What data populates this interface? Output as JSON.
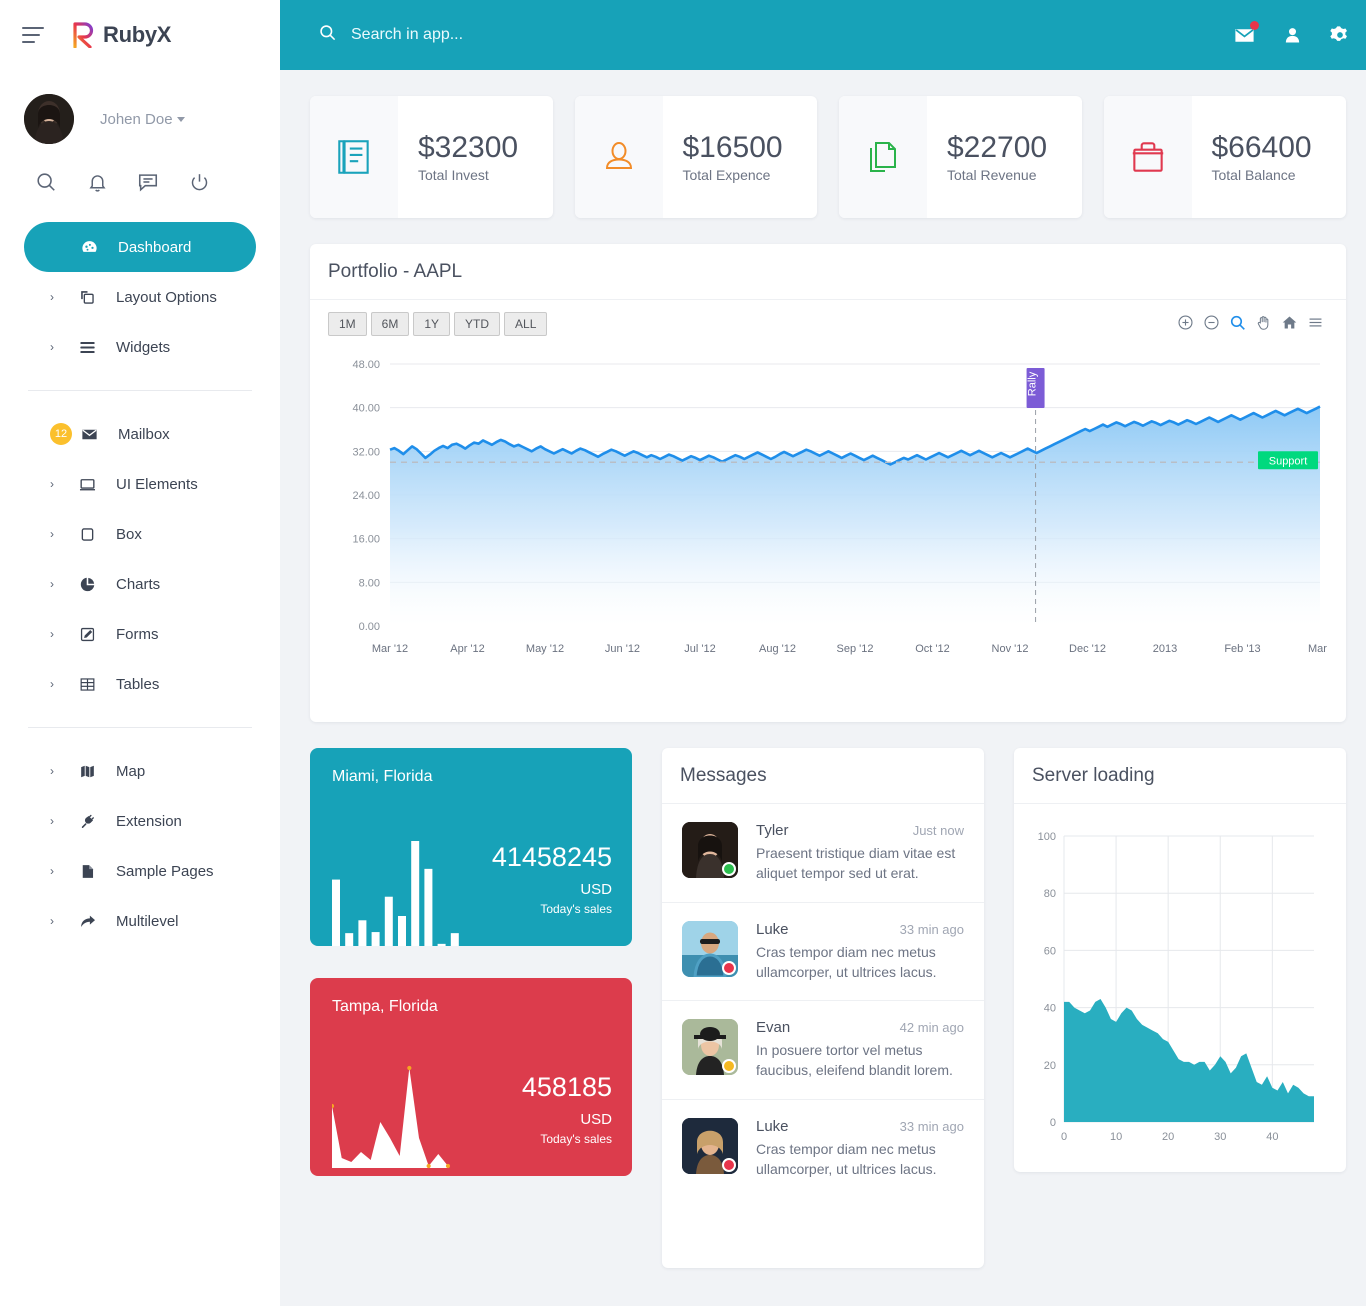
{
  "brand": {
    "name": "RubyX",
    "logo_icon": "rubyx-logo-icon",
    "menu_icon": "hamburger-icon"
  },
  "profile": {
    "name": "Johen Doe",
    "avatar_icon": "user-avatar"
  },
  "quick_icons": [
    "search-icon",
    "bell-icon",
    "chat-icon",
    "power-icon"
  ],
  "topbar": {
    "search_placeholder": "Search in app...",
    "search_value": "",
    "search_icon": "search-icon",
    "icons": [
      "envelope-icon",
      "user-icon",
      "gear-icon"
    ],
    "has_mail_badge": true,
    "bg_color": "#17a2b8"
  },
  "sidebar": {
    "items": [
      {
        "label": "Dashboard",
        "icon": "dashboard-icon",
        "active": true,
        "arrow": false,
        "badge": null
      },
      {
        "label": "Layout Options",
        "icon": "layers-icon",
        "active": false,
        "arrow": true,
        "badge": null
      },
      {
        "label": "Widgets",
        "icon": "widgets-icon",
        "active": false,
        "arrow": true,
        "badge": null
      },
      {
        "label": "Mailbox",
        "icon": "envelope-icon",
        "active": false,
        "arrow": false,
        "badge": "12"
      },
      {
        "label": "UI Elements",
        "icon": "window-icon",
        "active": false,
        "arrow": true,
        "badge": null
      },
      {
        "label": "Box",
        "icon": "box-icon",
        "active": false,
        "arrow": true,
        "badge": null
      },
      {
        "label": "Charts",
        "icon": "pie-chart-icon",
        "active": false,
        "arrow": true,
        "badge": null
      },
      {
        "label": "Forms",
        "icon": "edit-form-icon",
        "active": false,
        "arrow": true,
        "badge": null
      },
      {
        "label": "Tables",
        "icon": "table-icon",
        "active": false,
        "arrow": true,
        "badge": null
      },
      {
        "label": "Map",
        "icon": "map-icon",
        "active": false,
        "arrow": true,
        "badge": null
      },
      {
        "label": "Extension",
        "icon": "plug-icon",
        "active": false,
        "arrow": true,
        "badge": null
      },
      {
        "label": "Sample Pages",
        "icon": "page-icon",
        "active": false,
        "arrow": true,
        "badge": null
      },
      {
        "label": "Multilevel",
        "icon": "share-arrow-icon",
        "active": false,
        "arrow": true,
        "badge": null
      }
    ],
    "separator_after": [
      2,
      8
    ],
    "badge_color": "#fbc02d",
    "active_color": "#17a2b8"
  },
  "stats": [
    {
      "value": "$32300",
      "label": "Total Invest",
      "icon": "invoice-icon",
      "color": "#1aa3bb"
    },
    {
      "value": "$16500",
      "label": "Total Expence",
      "icon": "person-icon",
      "color": "#f28c28"
    },
    {
      "value": "$22700",
      "label": "Total Revenue",
      "icon": "copy-files-icon",
      "color": "#2ab34a"
    },
    {
      "value": "$66400",
      "label": "Total Balance",
      "icon": "briefcase-icon",
      "color": "#e0394f"
    }
  ],
  "portfolio": {
    "title": "Portfolio - AAPL",
    "ranges": [
      "1M",
      "6M",
      "1Y",
      "YTD",
      "ALL"
    ],
    "active_range": null,
    "tools": [
      "zoom-in-icon",
      "zoom-out-icon",
      "selection-zoom-icon",
      "pan-icon",
      "home-reset-icon",
      "menu-icon"
    ],
    "active_tool": "selection-zoom-icon"
  },
  "sales_cards": [
    {
      "city": "Miami, Florida",
      "amount": "41458245",
      "currency": "USD",
      "sub": "Today's sales",
      "color": "#17a2b8",
      "chart": "bars"
    },
    {
      "city": "Tampa, Florida",
      "amount": "458185",
      "currency": "USD",
      "sub": "Today's sales",
      "color": "#dc3c4c",
      "chart": "area"
    }
  ],
  "messages": {
    "title": "Messages",
    "items": [
      {
        "name": "Tyler",
        "time": "Just now",
        "text": "Praesent tristique diam vitae est aliquet tempor sed ut erat.",
        "status": "#2cbe4e",
        "avatar_bg": "#2c2722"
      },
      {
        "name": "Luke",
        "time": "33 min ago",
        "text": "Cras tempor diam nec metus ullamcorper, ut ultrices lacus.",
        "status": "#e8344b",
        "avatar_bg": "#7fc2de"
      },
      {
        "name": "Evan",
        "time": "42 min ago",
        "text": "In posuere tortor vel metus faucibus, eleifend blandit lorem.",
        "status": "#f5b921",
        "avatar_bg": "#b9c6a8"
      },
      {
        "name": "Luke",
        "time": "33 min ago",
        "text": "Cras tempor diam nec metus ullamcorper, ut ultrices lacus.",
        "status": "#e8344b",
        "avatar_bg": "#26344a"
      }
    ]
  },
  "server": {
    "title": "Server loading"
  },
  "chart_data": [
    {
      "type": "area",
      "name": "portfolio-aapl",
      "title": "Portfolio - AAPL",
      "xlabel": "",
      "ylabel": "",
      "ylim": [
        0,
        48
      ],
      "yticks": [
        "0.00",
        "8.00",
        "16.00",
        "24.00",
        "32.00",
        "40.00",
        "48.00"
      ],
      "xticks": [
        "Mar '12",
        "Apr '12",
        "May '12",
        "Jun '12",
        "Jul '12",
        "Aug '12",
        "Sep '12",
        "Oct '12",
        "Nov '12",
        "Dec '12",
        "2013",
        "Feb '13",
        "Mar '"
      ],
      "grid": true,
      "line_color": "#1f8eea",
      "fill_gradient": [
        "#a8d4f7",
        "#ffffff"
      ],
      "annotations": [
        {
          "label": "Rally",
          "type": "vertical-line",
          "color": "#7c5cd6",
          "x": "Nov '12",
          "orientation": "vertical"
        },
        {
          "label": "Support",
          "type": "horizontal-line",
          "color": "#00d97e",
          "y": 30
        }
      ],
      "values": [
        32.3,
        32.6,
        32.1,
        31.5,
        32.2,
        32.9,
        32.4,
        31.6,
        30.8,
        31.4,
        32.1,
        32.6,
        33.0,
        32.6,
        33.2,
        33.4,
        33.0,
        32.5,
        33.1,
        33.6,
        33.4,
        34.0,
        33.6,
        33.2,
        33.7,
        34.1,
        33.8,
        33.3,
        32.9,
        33.2,
        32.8,
        32.4,
        32.0,
        32.5,
        32.9,
        32.4,
        32.0,
        31.6,
        32.0,
        32.4,
        32.0,
        31.6,
        32.1,
        32.5,
        32.2,
        31.8,
        31.4,
        31.0,
        31.5,
        31.9,
        32.3,
        32.0,
        31.6,
        31.2,
        31.6,
        32.0,
        31.7,
        31.3,
        30.9,
        31.3,
        31.0,
        30.6,
        31.0,
        31.4,
        31.1,
        30.7,
        30.3,
        30.7,
        31.1,
        30.8,
        30.4,
        30.8,
        31.2,
        30.9,
        30.5,
        30.1,
        30.5,
        30.9,
        31.3,
        31.0,
        30.6,
        31.0,
        31.4,
        31.8,
        31.4,
        31.0,
        30.6,
        31.0,
        31.5,
        31.9,
        31.5,
        31.1,
        31.5,
        31.9,
        32.3,
        32.0,
        31.6,
        31.2,
        31.6,
        32.0,
        31.6,
        31.2,
        30.8,
        31.2,
        31.6,
        31.2,
        30.8,
        30.4,
        30.8,
        31.2,
        30.8,
        30.4,
        30.0,
        29.6,
        30.0,
        30.4,
        30.8,
        30.5,
        30.9,
        31.3,
        30.9,
        30.5,
        30.9,
        31.3,
        31.7,
        31.3,
        30.9,
        31.3,
        31.7,
        32.1,
        31.7,
        31.3,
        31.7,
        32.1,
        31.7,
        31.3,
        30.9,
        31.3,
        31.7,
        31.3,
        30.9,
        31.3,
        31.7,
        32.1,
        32.5,
        32.1,
        31.7,
        32.1,
        32.5,
        32.9,
        33.3,
        33.7,
        34.1,
        34.5,
        34.9,
        35.3,
        35.7,
        36.1,
        35.7,
        36.1,
        36.5,
        36.9,
        36.5,
        36.9,
        37.3,
        37.0,
        36.6,
        37.0,
        37.4,
        37.1,
        36.7,
        37.1,
        37.5,
        37.2,
        36.8,
        37.2,
        37.6,
        37.3,
        36.9,
        37.3,
        37.7,
        37.4,
        37.0,
        37.4,
        37.8,
        38.2,
        37.8,
        37.4,
        37.8,
        38.2,
        38.6,
        38.2,
        37.8,
        38.2,
        38.6,
        39.0,
        38.6,
        38.2,
        38.6,
        39.0,
        39.4,
        39.0,
        38.6,
        39.0,
        39.4,
        39.8,
        39.4,
        39.0,
        39.4,
        39.8,
        40.2
      ]
    },
    {
      "type": "area",
      "name": "server-loading",
      "title": "Server loading",
      "xlabel": "",
      "ylabel": "",
      "ylim": [
        0,
        100
      ],
      "xlim": [
        0,
        48
      ],
      "yticks": [
        0,
        20,
        40,
        60,
        80,
        100
      ],
      "xticks": [
        0,
        10,
        20,
        30,
        40
      ],
      "grid": true,
      "color": "#29aec0",
      "values": [
        42,
        42,
        40,
        39,
        38,
        39,
        42,
        43,
        40,
        36,
        35,
        38,
        40,
        39,
        36,
        34,
        33,
        32,
        31,
        29,
        28,
        25,
        22,
        21,
        21,
        20,
        21,
        21,
        18,
        20,
        23,
        21,
        17,
        19,
        23,
        24,
        19,
        14,
        13,
        16,
        12,
        11,
        14,
        10,
        13,
        12,
        10,
        9,
        9
      ]
    },
    {
      "type": "bar",
      "name": "miami-sparkline",
      "title": "Miami, Florida",
      "values": [
        62,
        12,
        24,
        13,
        46,
        28,
        98,
        72,
        2,
        12
      ],
      "color": "#ffffff"
    },
    {
      "type": "area",
      "name": "tampa-sparkline",
      "title": "Tampa, Florida",
      "values": [
        62,
        10,
        6,
        16,
        8,
        46,
        30,
        12,
        100,
        30,
        2,
        14,
        2
      ],
      "color": "#ffffff",
      "marker_color": "#f5a623"
    }
  ]
}
